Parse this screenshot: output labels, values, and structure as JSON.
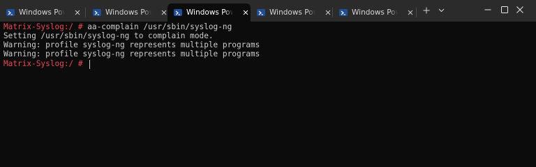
{
  "tabs": [
    {
      "title": "Windows PowerShell",
      "active": false
    },
    {
      "title": "Windows PowerShell",
      "active": false
    },
    {
      "title": "Windows PowerShell",
      "active": true
    },
    {
      "title": "Windows PowerShell",
      "active": false
    },
    {
      "title": "Windows PowerShell",
      "active": false
    }
  ],
  "tabbar": {
    "new_tab_icon": "plus-icon",
    "dropdown_icon": "chevron-down-icon"
  },
  "window_controls": [
    "minimize-icon",
    "maximize-icon",
    "close-icon"
  ],
  "terminal": {
    "lines": [
      {
        "prompt": "Matrix-Syslog:/ #",
        "command": " aa-complain /usr/sbin/syslog-ng"
      },
      {
        "output": "Setting /usr/sbin/syslog-ng to complain mode."
      },
      {
        "output": "Warning: profile syslog-ng represents multiple programs"
      },
      {
        "output": "Warning: profile syslog-ng represents multiple programs"
      },
      {
        "prompt": "Matrix-Syslog:/ #",
        "command": " "
      }
    ]
  },
  "colors": {
    "background": "#0c0c0c",
    "tabbar": "#2b2b2b",
    "prompt": "#e74856",
    "text": "#cccccc",
    "powershell_icon": "#1f4e95"
  }
}
